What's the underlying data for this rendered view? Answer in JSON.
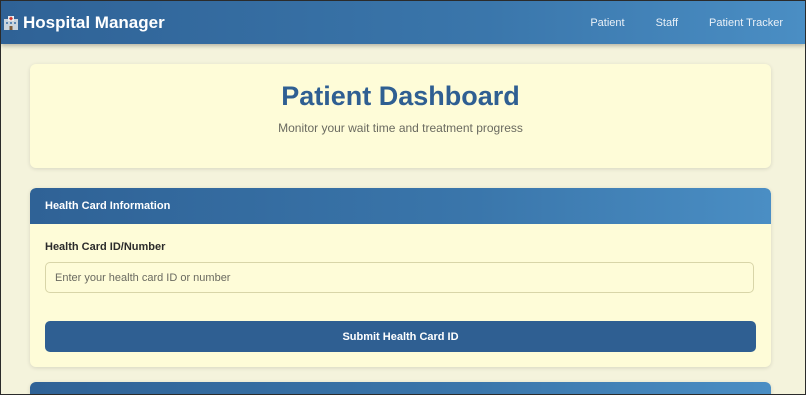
{
  "navbar": {
    "brand_icon": "hospital-icon",
    "brand_title": "Hospital Manager",
    "links": [
      "Patient",
      "Staff",
      "Patient Tracker"
    ]
  },
  "hero": {
    "title": "Patient Dashboard",
    "subtitle": "Monitor your wait time and treatment progress"
  },
  "health_card": {
    "header": "Health Card Information",
    "label": "Health Card ID/Number",
    "input_value": "",
    "placeholder": "Enter your health card ID or number",
    "submit_label": "Submit Health Card ID"
  },
  "colors": {
    "primary": "#2f5f92",
    "gradient_end": "#4a8ec4",
    "card_background": "#fefcd8",
    "page_background": "#f4f3dc"
  }
}
